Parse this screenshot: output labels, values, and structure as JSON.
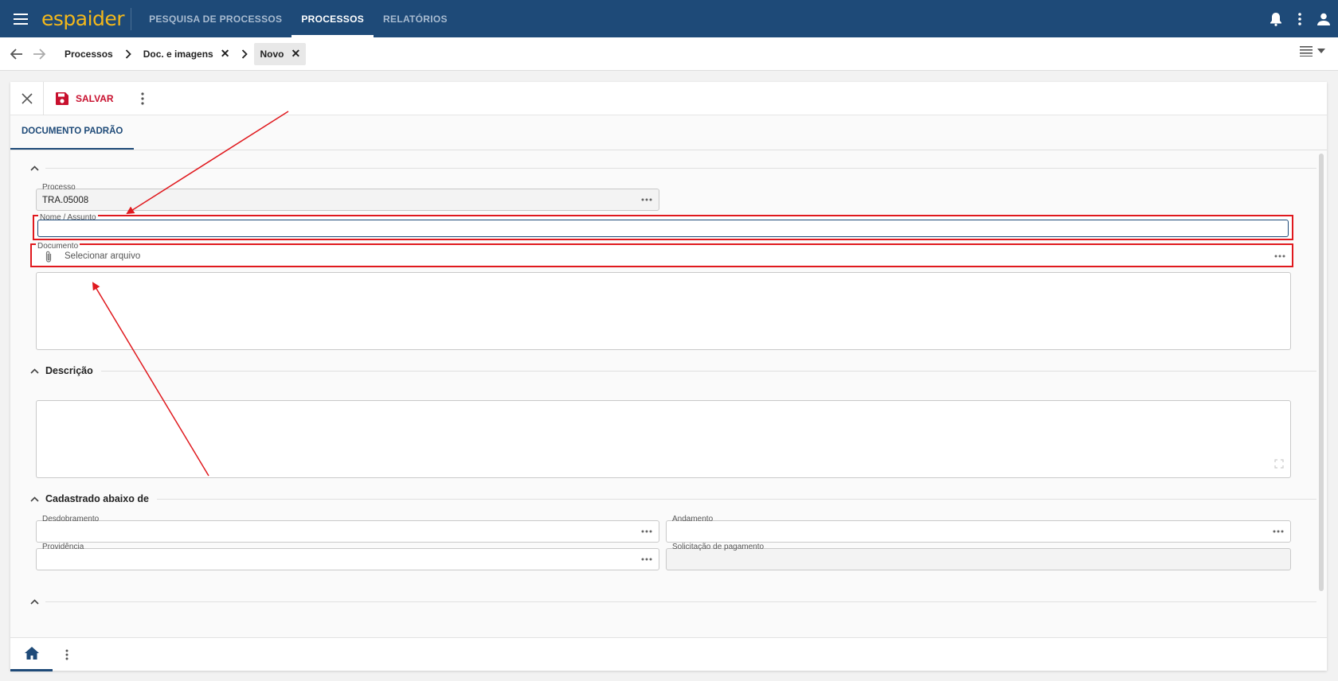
{
  "topbar": {
    "logo": "espaider",
    "nav": [
      {
        "label": "PESQUISA DE PROCESSOS",
        "active": false
      },
      {
        "label": "PROCESSOS",
        "active": true
      },
      {
        "label": "RELATÓRIOS",
        "active": false
      }
    ]
  },
  "breadcrumb": {
    "items": [
      {
        "label": "Processos",
        "closable": false
      },
      {
        "label": "Doc. e imagens",
        "closable": true
      },
      {
        "label": "Novo",
        "closable": true
      }
    ]
  },
  "toolbar": {
    "save_label": "SALVAR"
  },
  "tabs": [
    {
      "label": "DOCUMENTO PADRÃO",
      "active": true
    }
  ],
  "form": {
    "processo": {
      "label": "Processo",
      "value": "TRA.05008"
    },
    "nome_assunto": {
      "label": "Nome / Assunto",
      "value": ""
    },
    "documento": {
      "label": "Documento",
      "placeholder": "Selecionar arquivo"
    },
    "sections": {
      "descricao": "Descrição",
      "cadastrado": "Cadastrado abaixo de"
    },
    "desdobramento": {
      "label": "Desdobramento",
      "value": ""
    },
    "andamento": {
      "label": "Andamento",
      "value": ""
    },
    "providencia": {
      "label": "Providência",
      "value": ""
    },
    "solicitacao": {
      "label": "Solicitação de pagamento",
      "value": ""
    }
  },
  "colors": {
    "brand": "#1e4a78",
    "logo": "#f3b81b",
    "save": "#c8102e",
    "annotation": "#e0191e"
  }
}
